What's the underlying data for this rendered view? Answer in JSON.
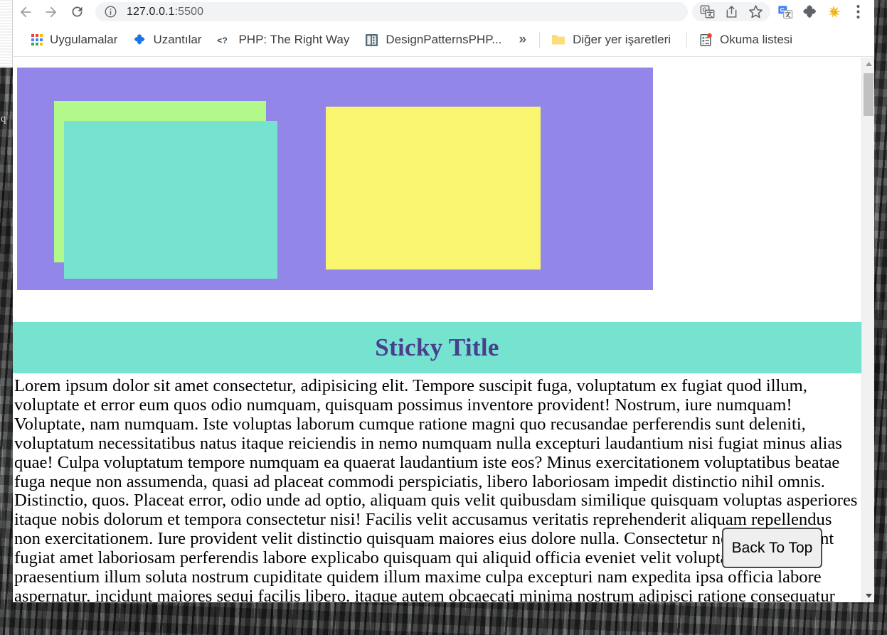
{
  "browser": {
    "nav": {
      "back_label": "Back",
      "forward_label": "Forward",
      "reload_label": "Reload"
    },
    "omnibox": {
      "url_host": "127.0.0.1",
      "url_port": ":5500",
      "site_info_icon": "info-circle-icon",
      "translate_icon": "translate-icon",
      "share_icon": "share-icon",
      "bookmark_icon": "star-icon"
    },
    "extensions": [
      {
        "name": "google-translate-extension-icon"
      },
      {
        "name": "puzzle-extensions-icon"
      },
      {
        "name": "honey-extension-icon"
      },
      {
        "name": "three-dot-menu-icon"
      }
    ],
    "bookmarks": {
      "items": [
        {
          "label": "Uygulamalar",
          "icon": "apps-grid-icon"
        },
        {
          "label": "Uzantılar",
          "icon": "puzzle-icon"
        },
        {
          "label": "PHP: The Right Way",
          "icon": "code-tag-icon"
        },
        {
          "label": "DesignPatternsPHP...",
          "icon": "book-icon"
        }
      ],
      "overflow_label": "»",
      "other_bookmarks": {
        "label": "Diğer yer işaretleri",
        "icon": "folder-icon"
      },
      "reading_list": {
        "label": "Okuma listesi",
        "icon": "reading-list-icon"
      }
    },
    "scrollbar": {
      "up_arrow": "▲",
      "down_arrow": "▼",
      "thumb_label": "scroll-thumb"
    }
  },
  "page": {
    "boxes": [
      {
        "name": "purple-container-box",
        "color": "#9287e8"
      },
      {
        "name": "green-box",
        "color": "#b2f98c"
      },
      {
        "name": "teal-box",
        "color": "#76e2d0"
      },
      {
        "name": "yellow-box",
        "color": "#faf56f"
      }
    ],
    "sticky_title": "Sticky Title",
    "sticky_title_bar_color": "#76e2d0",
    "sticky_title_text_color": "#4a3f8f",
    "paragraph": "Lorem ipsum dolor sit amet consectetur, adipisicing elit. Tempore suscipit fuga, voluptatum ex fugiat quod illum, voluptate et error eum quos odio numquam, quisquam possimus inventore provident! Nostrum, iure numquam! Voluptate, nam numquam. Iste voluptas laborum cumque ratione magni quo recusandae perferendis sunt deleniti, voluptatum necessitatibus natus itaque reiciendis in nemo numquam nulla excepturi laudantium nisi fugiat minus alias quae! Culpa voluptatum tempore numquam ea quaerat laudantium iste eos? Minus exercitationem voluptatibus beatae fuga neque non assumenda, quasi ad placeat commodi perspiciatis, libero laboriosam impedit distinctio nihil omnis. Distinctio, quos. Placeat error, odio unde ad optio, aliquam quis velit quibusdam similique quisquam voluptas asperiores itaque nobis dolorum et tempora consectetur nisi! Facilis velit accusamus veritatis reprehenderit aliquam repellendus non exercitationem. Iure provident velit distinctio quisquam maiores eius dolore nulla. Consectetur nesciunt deserunt fugiat amet laboriosam perferendis labore explicabo quisquam qui aliquid officia eveniet velit voluptatem, corporis praesentium illum soluta nostrum cupiditate quidem illum maxime culpa excepturi nam expedita ipsa officia labore aspernatur, incidunt maiores sequi facilis libero, itaque autem obcaecati minima nostrum adipisci ratione consequatur amet eum! Aliquam, doloribus! Id fugit",
    "back_to_top_label": "Back To Top"
  },
  "background_window": {
    "sliver_text": "q"
  }
}
